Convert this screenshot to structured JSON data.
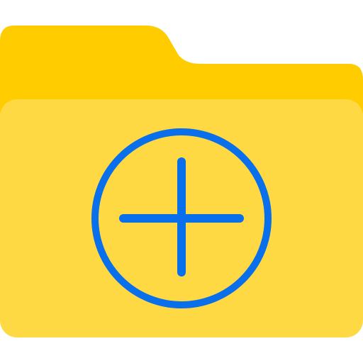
{
  "icon": {
    "name": "folder-add-icon",
    "colors": {
      "background": "#ffffff",
      "folder_back": "#FFCC00",
      "folder_front": "#FFD944",
      "plus_stroke": "#0A6FEB"
    }
  }
}
